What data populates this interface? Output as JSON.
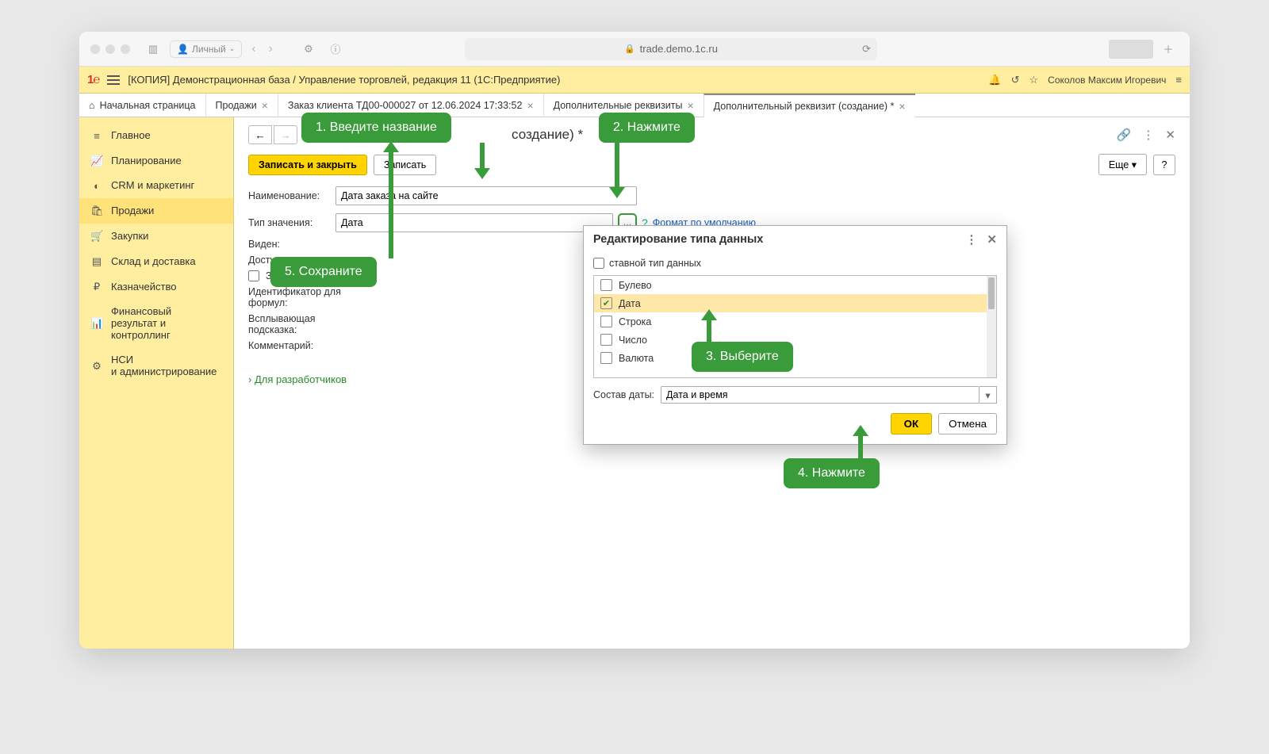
{
  "browser": {
    "profile": "Личный",
    "url_display": "trade.demo.1c.ru"
  },
  "app": {
    "title": "[КОПИЯ] Демонстрационная база / Управление торговлей, редакция 11  (1С:Предприятие)",
    "user": "Соколов Максим Игоревич"
  },
  "tabs": {
    "home": "Начальная страница",
    "t1": "Продажи",
    "t2": "Заказ клиента ТД00-000027 от 12.06.2024 17:33:52",
    "t3": "Дополнительные реквизиты",
    "t4": "Дополнительный реквизит (создание) *"
  },
  "sidebar": {
    "items": [
      "Главное",
      "Планирование",
      "CRM и маркетинг",
      "Продажи",
      "Закупки",
      "Склад и доставка",
      "Казначейство",
      "Финансовый\nрезультат и контроллинг",
      "НСИ\nи администрирование"
    ]
  },
  "page": {
    "title_fragment": "создание) *",
    "save_close": "Записать и закрыть",
    "save": "Записать",
    "more": "Еще",
    "help": "?",
    "labels": {
      "name": "Наименование:",
      "type": "Тип значения:",
      "visible": "Виден:",
      "available": "Доступен:",
      "formula_id": "Идентификатор для формул:",
      "tooltip": "Всплывающая\nподсказка:",
      "comment": "Комментарий:"
    },
    "name_value": "Дата заказа на сайте",
    "type_value": "Дата",
    "format_link": "Формат по умолчанию",
    "za_checkbox": "За",
    "dev_link": "Для разработчиков"
  },
  "dialog": {
    "title": "Редактирование типа данных",
    "composite": "ставной тип данных",
    "options": [
      "Булево",
      "Дата",
      "Строка",
      "Число",
      "Валюта"
    ],
    "compose_label": "Состав даты:",
    "compose_value": "Дата и время",
    "ok": "ОК",
    "cancel": "Отмена"
  },
  "callouts": {
    "c1": "1. Введите название",
    "c2": "2. Нажмите",
    "c3": "3. Выберите",
    "c4": "4. Нажмите",
    "c5": "5. Сохраните"
  }
}
